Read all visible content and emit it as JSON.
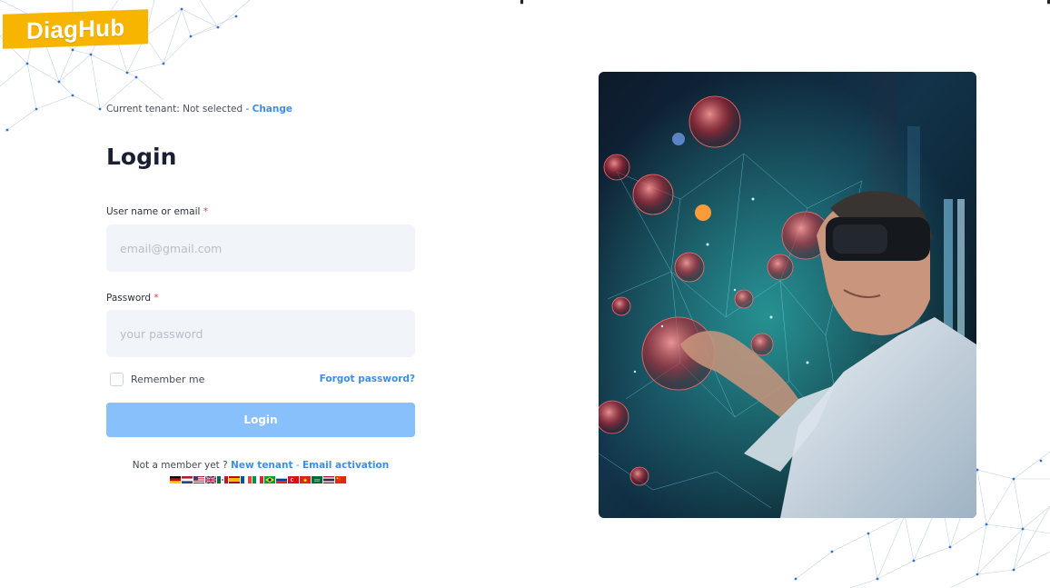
{
  "brand": {
    "name": "DiagHub",
    "color": "#f7b500"
  },
  "tenant": {
    "prefix": "Current tenant: Not selected - ",
    "change_label": "Change"
  },
  "login": {
    "title": "Login",
    "username_label": "User name or email",
    "username_placeholder": "email@gmail.com",
    "password_label": "Password",
    "password_placeholder": "your password",
    "required_marker": "*",
    "remember_label": "Remember me",
    "forgot_label": "Forgot password?",
    "submit_label": "Login"
  },
  "signup": {
    "prefix": "Not a member yet ?",
    "new_tenant_label": "New tenant",
    "separator": "-",
    "email_activation_label": "Email activation"
  },
  "languages": [
    {
      "code": "de",
      "name": "Deutsch"
    },
    {
      "code": "nl",
      "name": "Nederlands"
    },
    {
      "code": "us",
      "name": "English (US)"
    },
    {
      "code": "gb",
      "name": "English (UK)"
    },
    {
      "code": "mx",
      "name": "Español (México)"
    },
    {
      "code": "es",
      "name": "Español"
    },
    {
      "code": "fr",
      "name": "Français"
    },
    {
      "code": "it",
      "name": "Italiano"
    },
    {
      "code": "br",
      "name": "Português (Brasil)"
    },
    {
      "code": "ru",
      "name": "Русский"
    },
    {
      "code": "tr",
      "name": "Türkçe"
    },
    {
      "code": "vn",
      "name": "Tiếng Việt"
    },
    {
      "code": "sa",
      "name": "العربية"
    },
    {
      "code": "th",
      "name": "ไทย"
    },
    {
      "code": "cn",
      "name": "中文"
    }
  ],
  "hero_image": {
    "subject": "man-with-vr-headset-molecules"
  },
  "colors": {
    "link": "#3b8fe8",
    "button": "#87c0fa",
    "input_bg": "#f1f4f8"
  }
}
